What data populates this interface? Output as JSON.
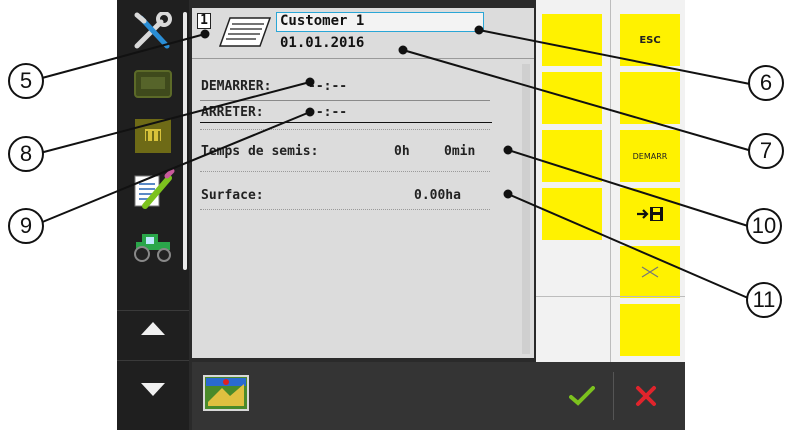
{
  "header": {
    "doc_number": "1",
    "customer": "Customer 1",
    "date": "01.01.2016"
  },
  "fields": {
    "start_label": "DEMARRER:",
    "start_value": "--:--",
    "stop_label": "ARRETER:",
    "stop_value": "--:--",
    "seeding_time_label": "Temps de semis:",
    "seeding_time_hours": "0h",
    "seeding_time_minutes": "0min",
    "surface_label": "Surface:",
    "surface_value": "0.00ha"
  },
  "softkeys": {
    "esc_label": "ESC",
    "start_label": "DEMARR",
    "save_icon": "arrow-save-icon",
    "delete_icon": "cross-line-icon"
  },
  "nav": {
    "items": [
      "tools-icon",
      "display-icon",
      "counter-icon",
      "edit-document-icon",
      "tractor-icon",
      "arrow-up-icon",
      "arrow-down-icon"
    ]
  },
  "bottom": {
    "icon": "field-map-icon",
    "ok": "check-icon",
    "cancel": "cross-icon"
  },
  "callouts": [
    "5",
    "6",
    "7",
    "8",
    "9",
    "10",
    "11"
  ],
  "colors": {
    "softkey": "#fff200",
    "accent_border": "#2aa6d6",
    "ok": "#7cc21e",
    "cancel": "#e0242c"
  }
}
